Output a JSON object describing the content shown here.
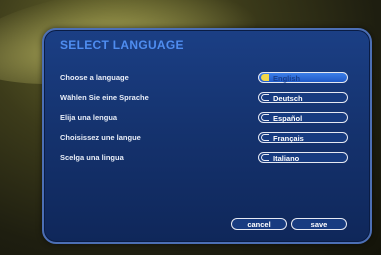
{
  "title": "SELECT LANGUAGE",
  "prompts": [
    "Choose a language",
    "Wählen Sie eine Sprache",
    "Elija una lengua",
    "Choisissez une langue",
    "Scelga una lingua"
  ],
  "languages": [
    {
      "label": "English",
      "selected": true
    },
    {
      "label": "Deutsch",
      "selected": false
    },
    {
      "label": "Español",
      "selected": false
    },
    {
      "label": "Français",
      "selected": false
    },
    {
      "label": "Italiano",
      "selected": false
    }
  ],
  "actions": {
    "cancel": "cancel",
    "save": "save"
  },
  "colors": {
    "accent": "#4f8df0",
    "panel": "#15336f",
    "selected": "#2a6ad8",
    "radio_selected": "#f2d84a"
  }
}
